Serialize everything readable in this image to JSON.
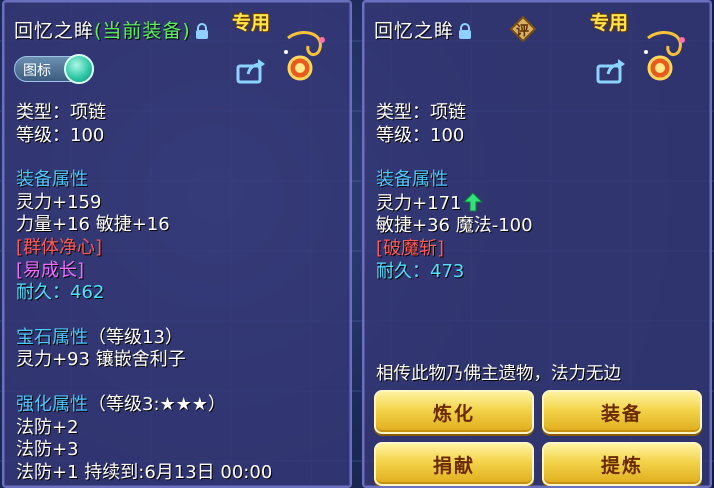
{
  "left_panel": {
    "title_name": "回忆之眸",
    "title_status": "(当前装备)",
    "special_label": "专用",
    "toggle_label": "图标",
    "type_line": "类型：项链",
    "level_line": "等级：100",
    "attr_header": "装备属性",
    "attr_lines": [
      "灵力+159",
      "力量+16 敏捷+16"
    ],
    "special_attr": "[群体净心]",
    "special_attr2": "[易成长]",
    "durability": "耐久：462",
    "gem_header": "宝石属性",
    "gem_level": "（等级13）",
    "gem_line": "灵力+93 镶嵌舍利子",
    "enhance_header": "强化属性",
    "enhance_level": "（等级3:★★★）",
    "enhance_lines": [
      "法防+2",
      "法防+3",
      "法防+1    持续到:6月13日 00:00"
    ]
  },
  "right_panel": {
    "title_name": "回忆之眸",
    "special_label": "专用",
    "rate_badge": "评",
    "type_line": "类型：项链",
    "level_line": "等级：100",
    "attr_header": "装备属性",
    "attr_line1": "灵力+171",
    "attr_line2": "敏捷+36 魔法-100",
    "special_attr": "[破魔斩]",
    "durability": "耐久：473",
    "description": "相传此物乃佛主遗物，法力无边",
    "buttons": {
      "refine": "炼化",
      "equip": "装备",
      "donate": "捐献",
      "extract": "提炼"
    }
  },
  "colors": {
    "panel_bg": "#343876",
    "header_blue": "#4fc7ff",
    "green_status": "#5cf05c",
    "red_attr": "#ff5a5a",
    "magenta_attr": "#f06cff",
    "button_gold": "#f3d34a"
  },
  "icons": [
    "lock-icon",
    "rate-icon",
    "ornament-icon",
    "share-icon",
    "arrow-up-icon"
  ]
}
